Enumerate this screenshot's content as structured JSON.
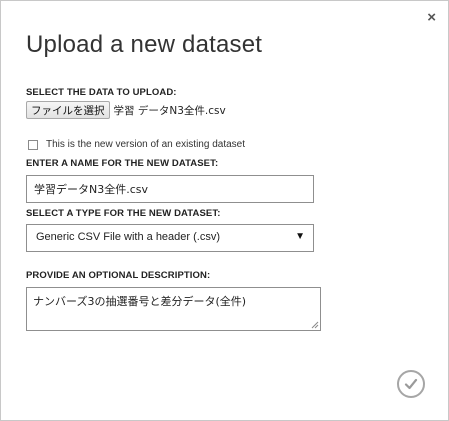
{
  "dialog": {
    "close_label": "×",
    "title": "Upload a new dataset"
  },
  "upload": {
    "label": "SELECT THE DATA TO UPLOAD:",
    "file_button_label": "ファイルを選択",
    "file_name": "学習 データN3全件.csv"
  },
  "new_version": {
    "label": "This is the new version of an existing dataset",
    "checked": false
  },
  "dataset_name": {
    "label": "ENTER A NAME FOR THE NEW DATASET:",
    "value": "学習データN3全件.csv"
  },
  "dataset_type": {
    "label": "SELECT A TYPE FOR THE NEW DATASET:",
    "selected": "Generic CSV File with a header (.csv)",
    "arrow": "▼"
  },
  "description": {
    "label": "PROVIDE AN OPTIONAL DESCRIPTION:",
    "value": "ナンバーズ3の抽選番号と差分データ(全件)"
  },
  "icons": {
    "close": "close-icon",
    "ok": "checkmark-icon",
    "dropdown": "chevron-down-icon"
  },
  "colors": {
    "border": "#8f8f8f",
    "ok_circle": "#a6a6a6"
  }
}
